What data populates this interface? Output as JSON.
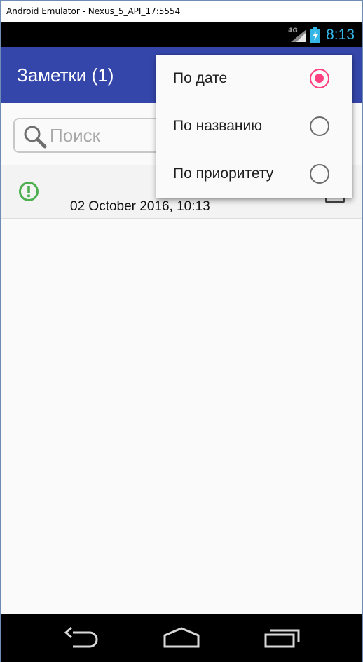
{
  "window": {
    "title": "Android Emulator - Nexus_5_API_17:5554"
  },
  "status_bar": {
    "network": "4G",
    "time": "8:13",
    "clock_color": "#33b5e5"
  },
  "app_bar": {
    "title": "Заметки (1)",
    "color": "#3546ab"
  },
  "search": {
    "placeholder": "Поиск",
    "value": "",
    "icon": "search-icon"
  },
  "notes": [
    {
      "date": "02 October 2016,  10:13",
      "priority_icon": "alert-circle-icon",
      "priority_color": "#4caf50"
    }
  ],
  "sort_menu": {
    "accent": "#ff4081",
    "items": [
      {
        "label": "По дате",
        "selected": true
      },
      {
        "label": "По названию",
        "selected": false
      },
      {
        "label": "По приоритету",
        "selected": false
      }
    ]
  },
  "nav_bar": {
    "buttons": [
      "back-icon",
      "home-icon",
      "recent-apps-icon"
    ]
  }
}
